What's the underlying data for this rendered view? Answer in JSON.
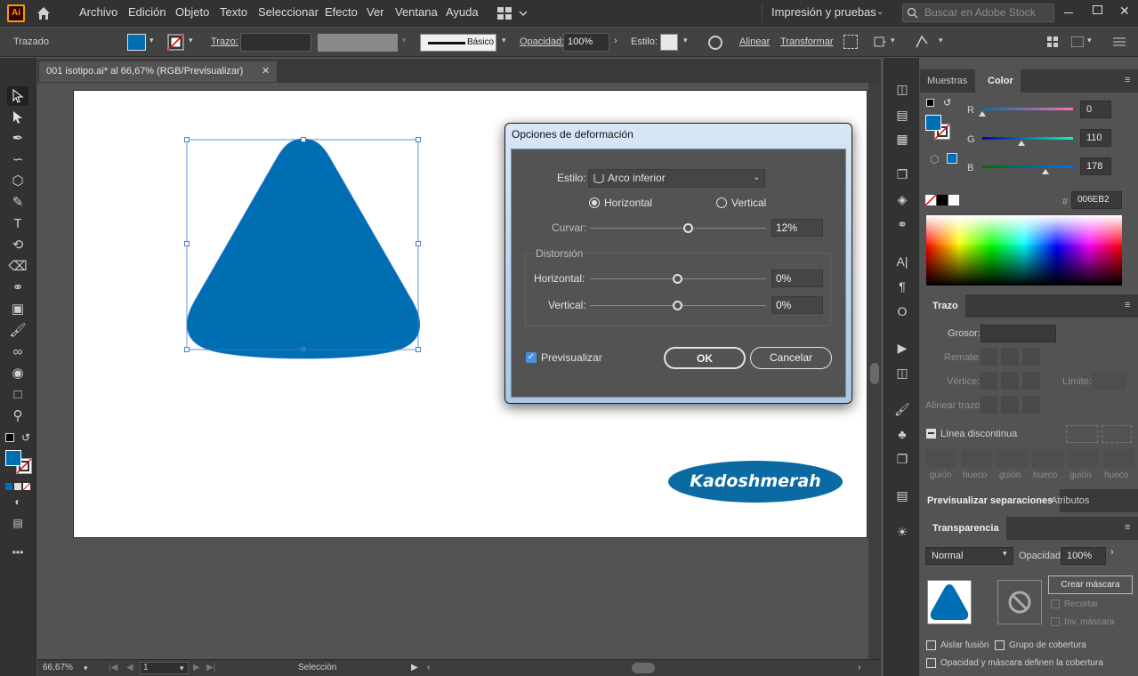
{
  "menubar": {
    "app_icon": "Ai",
    "items": [
      "Archivo",
      "Edición",
      "Objeto",
      "Texto",
      "Seleccionar",
      "Efecto",
      "Ver",
      "Ventana",
      "Ayuda"
    ],
    "workspace": "Impresión y pruebas",
    "search_placeholder": "Buscar en Adobe Stock"
  },
  "controlbar": {
    "object_type": "Trazado",
    "stroke_label": "Trazo:",
    "brush_label": "Básico",
    "opacity_label": "Opacidad:",
    "opacity_value": "100%",
    "style_label": "Estilo:",
    "align_label": "Alinear",
    "transform_label": "Transformar"
  },
  "document": {
    "tab_title": "001 isotipo.ai* al 66,67% (RGB/Previsualizar)",
    "zoom": "66,67%",
    "artboard_number": "1",
    "status_tool": "Selección",
    "watermark": "Kadoshmerah",
    "shape_color": "#006EB2"
  },
  "dialog": {
    "title": "Opciones de deformación",
    "style_label": "Estilo:",
    "style_value": "Arco inferior",
    "horizontal_label": "Horizontal",
    "vertical_label": "Vertical",
    "bend_label": "Curvar:",
    "bend_value": "12%",
    "bend_fraction": 0.56,
    "distortion_label": "Distorsión",
    "dist_h_label": "Horizontal:",
    "dist_h_value": "0%",
    "dist_v_label": "Vertical:",
    "dist_v_value": "0%",
    "preview_label": "Previsualizar",
    "ok_label": "OK",
    "cancel_label": "Cancelar"
  },
  "color_panel": {
    "tabs": [
      "Muestras",
      "Color"
    ],
    "r_label": "R",
    "r_value": "0",
    "g_label": "G",
    "g_value": "110",
    "b_label": "B",
    "b_value": "178",
    "hex_label": "#",
    "hex_value": "006EB2"
  },
  "stroke_panel": {
    "title": "Trazo",
    "weight_label": "Grosor:",
    "cap_label": "Remate:",
    "corner_label": "Vértice:",
    "limit_label": "Límite:",
    "align_label": "Alinear trazo:",
    "dashed_label": "Línea discontinua",
    "dash_labels": [
      "guión",
      "hueco",
      "guión",
      "hueco",
      "guión",
      "hueco"
    ]
  },
  "sep_panel": {
    "tabs": [
      "Previsualizar separaciones",
      "Atributos"
    ]
  },
  "transparency_panel": {
    "title": "Transparencia",
    "blend_mode": "Normal",
    "opacity_label": "Opacidad:",
    "opacity_value": "100%",
    "make_mask": "Crear máscara",
    "clip": "Recortar",
    "invert": "Inv. máscara",
    "isolate": "Aislar fusión",
    "knockout": "Grupo de cobertura",
    "opacity_mask": "Opacidad y máscara definen la cobertura"
  }
}
